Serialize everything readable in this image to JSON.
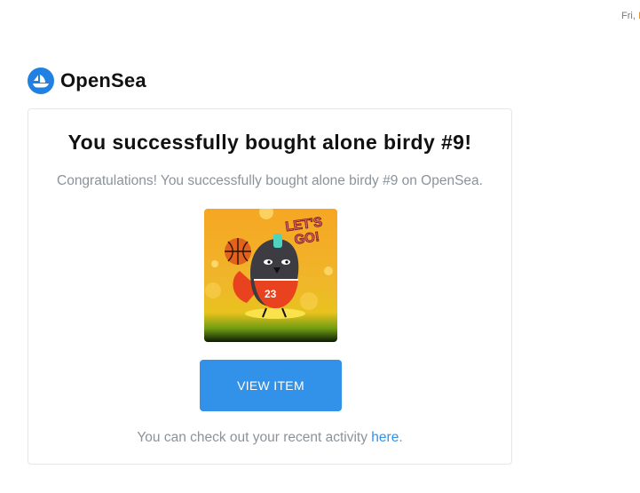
{
  "header": {
    "date_text_visible": "Fri,",
    "date_text_cut": "I"
  },
  "brand": {
    "name": "OpenSea",
    "logo_icon": "opensea-ship-icon",
    "accent_color": "#2081e2"
  },
  "email": {
    "title": "You successfully bought alone birdy #9!",
    "message": "Congratulations! You successfully bought alone birdy #9 on OpenSea.",
    "nft_image": {
      "name": "alone birdy #9",
      "sticker_text_line1": "LET'S",
      "sticker_text_line2": "GO!",
      "jersey_number": "23"
    },
    "button_label": "VIEW ITEM",
    "button_color": "#3291e9",
    "footer_text": "You can check out your recent activity",
    "footer_link": "here",
    "footer_end": "."
  }
}
